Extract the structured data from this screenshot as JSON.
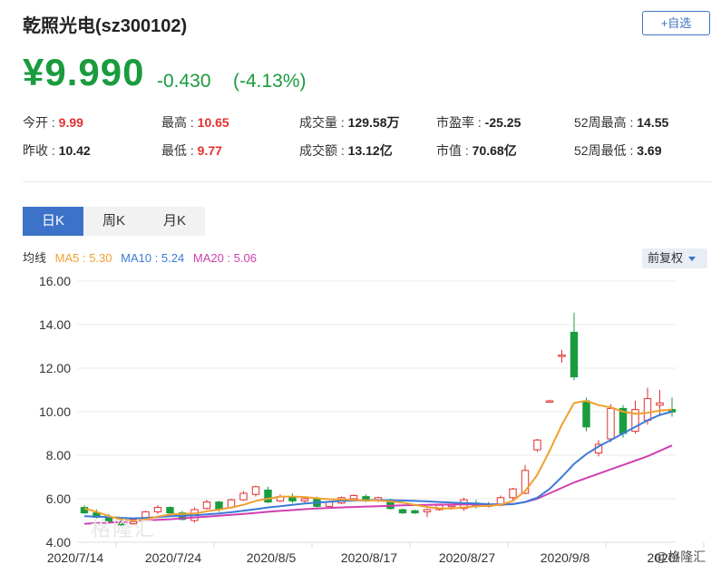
{
  "header": {
    "title": "乾照光电(sz300102)",
    "add_button": "+自选",
    "price": "¥9.990",
    "change": "-0.430",
    "change_pct": "(-4.13%)",
    "price_color": "#1a9c3e"
  },
  "stats": [
    {
      "label": "今开 : ",
      "value": "9.99",
      "red": true
    },
    {
      "label": "最高 : ",
      "value": "10.65",
      "red": true
    },
    {
      "label": "成交量 : ",
      "value": "129.58万",
      "red": false
    },
    {
      "label": "市盈率 : ",
      "value": "-25.25",
      "red": false
    },
    {
      "label": "52周最高 : ",
      "value": "14.55",
      "red": false
    },
    {
      "label": "昨收 : ",
      "value": "10.42",
      "red": false
    },
    {
      "label": "最低 : ",
      "value": "9.77",
      "red": true
    },
    {
      "label": "成交额 : ",
      "value": "13.12亿",
      "red": false
    },
    {
      "label": "市值 : ",
      "value": "70.68亿",
      "red": false
    },
    {
      "label": "52周最低 : ",
      "value": "3.69",
      "red": false
    }
  ],
  "tabs": {
    "day": "日K",
    "week": "周K",
    "month": "月K"
  },
  "legend": {
    "prefix": "均线",
    "ma5": "MA5 : 5.30",
    "ma10": "MA10 : 5.24",
    "ma20": "MA20 : 5.06"
  },
  "adjust_button": "前复权",
  "watermark_left": "格隆汇",
  "watermark_right": "@格隆汇",
  "colors": {
    "up": "#e03030",
    "down": "#1a9c3e",
    "ma5": "#f0a030",
    "ma10": "#3c7ad8",
    "ma20": "#d040b0",
    "accent": "#3c73c8"
  },
  "chart_data": {
    "type": "candlestick",
    "ylim": [
      4,
      16
    ],
    "y_ticks": [
      "16.00",
      "14.00",
      "12.00",
      "10.00",
      "8.00",
      "6.00",
      "4.00"
    ],
    "x_ticks": [
      {
        "label": "2020/7/14",
        "index": 0
      },
      {
        "label": "2020/7/24",
        "index": 8
      },
      {
        "label": "2020/8/5",
        "index": 16
      },
      {
        "label": "2020/8/17",
        "index": 24
      },
      {
        "label": "2020/8/27",
        "index": 32
      },
      {
        "label": "2020/9/8",
        "index": 40
      },
      {
        "label": "2020/",
        "index": 48
      }
    ],
    "candles": [
      {
        "o": 5.6,
        "h": 5.7,
        "l": 5.3,
        "c": 5.35
      },
      {
        "o": 5.35,
        "h": 5.5,
        "l": 5.1,
        "c": 5.15
      },
      {
        "o": 5.15,
        "h": 5.3,
        "l": 4.9,
        "c": 4.95
      },
      {
        "o": 4.9,
        "h": 5.0,
        "l": 4.75,
        "c": 4.8
      },
      {
        "o": 4.85,
        "h": 5.1,
        "l": 4.8,
        "c": 5.05
      },
      {
        "o": 5.05,
        "h": 5.45,
        "l": 5.0,
        "c": 5.4
      },
      {
        "o": 5.4,
        "h": 5.7,
        "l": 5.3,
        "c": 5.6
      },
      {
        "o": 5.6,
        "h": 5.65,
        "l": 5.3,
        "c": 5.35
      },
      {
        "o": 5.35,
        "h": 5.45,
        "l": 5.0,
        "c": 5.05
      },
      {
        "o": 5.0,
        "h": 5.6,
        "l": 4.9,
        "c": 5.5
      },
      {
        "o": 5.55,
        "h": 5.95,
        "l": 5.5,
        "c": 5.85
      },
      {
        "o": 5.85,
        "h": 5.9,
        "l": 5.4,
        "c": 5.5
      },
      {
        "o": 5.6,
        "h": 6.0,
        "l": 5.55,
        "c": 5.95
      },
      {
        "o": 5.95,
        "h": 6.35,
        "l": 5.9,
        "c": 6.25
      },
      {
        "o": 6.2,
        "h": 6.6,
        "l": 6.1,
        "c": 6.55
      },
      {
        "o": 6.4,
        "h": 6.55,
        "l": 5.8,
        "c": 5.85
      },
      {
        "o": 5.9,
        "h": 6.2,
        "l": 5.85,
        "c": 6.1
      },
      {
        "o": 6.1,
        "h": 6.25,
        "l": 5.8,
        "c": 5.9
      },
      {
        "o": 5.9,
        "h": 6.05,
        "l": 5.8,
        "c": 6.0
      },
      {
        "o": 6.0,
        "h": 6.1,
        "l": 5.6,
        "c": 5.65
      },
      {
        "o": 5.65,
        "h": 5.9,
        "l": 5.6,
        "c": 5.85
      },
      {
        "o": 5.8,
        "h": 6.1,
        "l": 5.75,
        "c": 6.05
      },
      {
        "o": 6.0,
        "h": 6.2,
        "l": 5.9,
        "c": 6.15
      },
      {
        "o": 6.1,
        "h": 6.2,
        "l": 5.85,
        "c": 5.9
      },
      {
        "o": 5.95,
        "h": 6.1,
        "l": 5.85,
        "c": 6.05
      },
      {
        "o": 5.95,
        "h": 6.0,
        "l": 5.5,
        "c": 5.55
      },
      {
        "o": 5.5,
        "h": 5.55,
        "l": 5.3,
        "c": 5.35
      },
      {
        "o": 5.45,
        "h": 5.5,
        "l": 5.3,
        "c": 5.35
      },
      {
        "o": 5.4,
        "h": 5.55,
        "l": 5.15,
        "c": 5.5
      },
      {
        "o": 5.5,
        "h": 5.75,
        "l": 5.45,
        "c": 5.7
      },
      {
        "o": 5.65,
        "h": 5.8,
        "l": 5.5,
        "c": 5.7
      },
      {
        "o": 5.55,
        "h": 6.05,
        "l": 5.45,
        "c": 5.95
      },
      {
        "o": 5.8,
        "h": 5.95,
        "l": 5.55,
        "c": 5.65
      },
      {
        "o": 5.65,
        "h": 5.85,
        "l": 5.6,
        "c": 5.75
      },
      {
        "o": 5.7,
        "h": 6.15,
        "l": 5.65,
        "c": 6.05
      },
      {
        "o": 6.05,
        "h": 6.5,
        "l": 5.95,
        "c": 6.45
      },
      {
        "o": 6.25,
        "h": 7.55,
        "l": 6.2,
        "c": 7.3
      },
      {
        "o": 8.25,
        "h": 8.75,
        "l": 8.15,
        "c": 8.7
      },
      {
        "o": 10.5,
        "h": 10.55,
        "l": 10.45,
        "c": 10.5
      },
      {
        "o": 12.6,
        "h": 12.85,
        "l": 12.25,
        "c": 12.6
      },
      {
        "o": 13.65,
        "h": 14.55,
        "l": 11.45,
        "c": 11.6
      },
      {
        "o": 10.5,
        "h": 10.65,
        "l": 9.1,
        "c": 9.3
      },
      {
        "o": 8.1,
        "h": 8.7,
        "l": 7.95,
        "c": 8.5
      },
      {
        "o": 8.75,
        "h": 10.35,
        "l": 8.6,
        "c": 10.15
      },
      {
        "o": 10.15,
        "h": 10.3,
        "l": 8.8,
        "c": 9.0
      },
      {
        "o": 9.1,
        "h": 10.5,
        "l": 9.0,
        "c": 10.1
      },
      {
        "o": 9.6,
        "h": 11.1,
        "l": 9.4,
        "c": 10.6
      },
      {
        "o": 10.3,
        "h": 11.0,
        "l": 9.8,
        "c": 10.4
      },
      {
        "o": 10.1,
        "h": 10.65,
        "l": 9.77,
        "c": 9.99
      }
    ],
    "ma5": [
      5.55,
      5.4,
      5.2,
      5.05,
      4.98,
      5.05,
      5.18,
      5.28,
      5.3,
      5.32,
      5.42,
      5.5,
      5.6,
      5.72,
      5.9,
      6.0,
      6.1,
      6.1,
      6.08,
      6.02,
      5.98,
      5.97,
      5.95,
      5.93,
      5.92,
      5.88,
      5.82,
      5.72,
      5.62,
      5.55,
      5.55,
      5.6,
      5.65,
      5.68,
      5.72,
      5.9,
      6.35,
      7.1,
      8.2,
      9.4,
      10.4,
      10.5,
      10.3,
      10.2,
      10.0,
      9.9,
      9.95,
      10.05,
      10.1
    ],
    "ma10": [
      5.2,
      5.18,
      5.16,
      5.12,
      5.1,
      5.12,
      5.16,
      5.2,
      5.22,
      5.24,
      5.28,
      5.32,
      5.38,
      5.45,
      5.52,
      5.6,
      5.66,
      5.72,
      5.78,
      5.82,
      5.86,
      5.9,
      5.92,
      5.93,
      5.94,
      5.93,
      5.92,
      5.9,
      5.88,
      5.85,
      5.82,
      5.8,
      5.78,
      5.75,
      5.73,
      5.75,
      5.85,
      6.05,
      6.45,
      7.0,
      7.6,
      8.05,
      8.4,
      8.7,
      9.0,
      9.3,
      9.6,
      9.85,
      10.0
    ],
    "ma20": [
      4.85,
      4.88,
      4.9,
      4.93,
      4.96,
      5.0,
      5.03,
      5.06,
      5.1,
      5.14,
      5.18,
      5.22,
      5.26,
      5.3,
      5.35,
      5.4,
      5.44,
      5.48,
      5.52,
      5.55,
      5.58,
      5.6,
      5.62,
      5.64,
      5.66,
      5.68,
      5.7,
      5.71,
      5.72,
      5.73,
      5.73,
      5.74,
      5.74,
      5.74,
      5.74,
      5.76,
      5.85,
      6.0,
      6.25,
      6.5,
      6.75,
      6.95,
      7.15,
      7.35,
      7.55,
      7.75,
      7.95,
      8.2,
      8.45
    ]
  }
}
